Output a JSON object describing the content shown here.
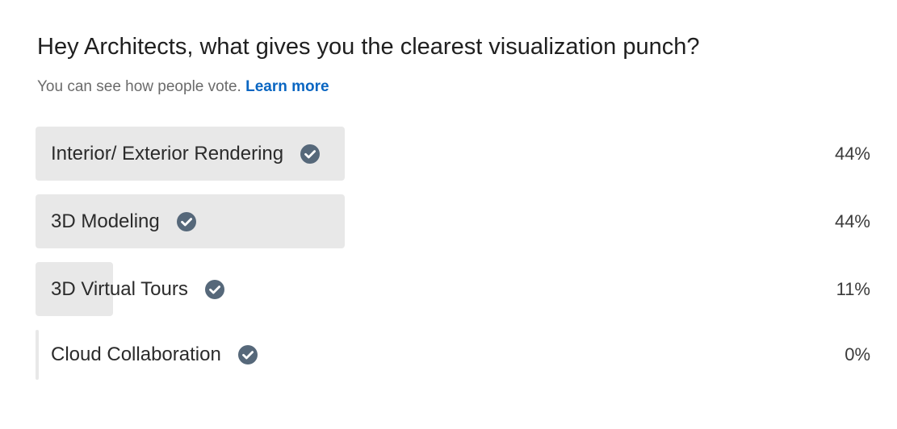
{
  "poll": {
    "question": "Hey Architects, what gives you the clearest visualization punch?",
    "subtitle": "You can see how people vote.",
    "learn_more": "Learn more",
    "options": [
      {
        "label": "Interior/ Exterior Rendering",
        "percent": "44%",
        "fill": 0.44,
        "checked": true
      },
      {
        "label": "3D Modeling",
        "percent": "44%",
        "fill": 0.44,
        "checked": true
      },
      {
        "label": "3D Virtual Tours",
        "percent": "11%",
        "fill": 0.11,
        "checked": true
      },
      {
        "label": "Cloud Collaboration",
        "percent": "0%",
        "fill": 0.0,
        "checked": true
      }
    ],
    "colors": {
      "bar_fill": "#e8e8e8",
      "check_icon": "#56687a",
      "link": "#0a66c2"
    }
  }
}
